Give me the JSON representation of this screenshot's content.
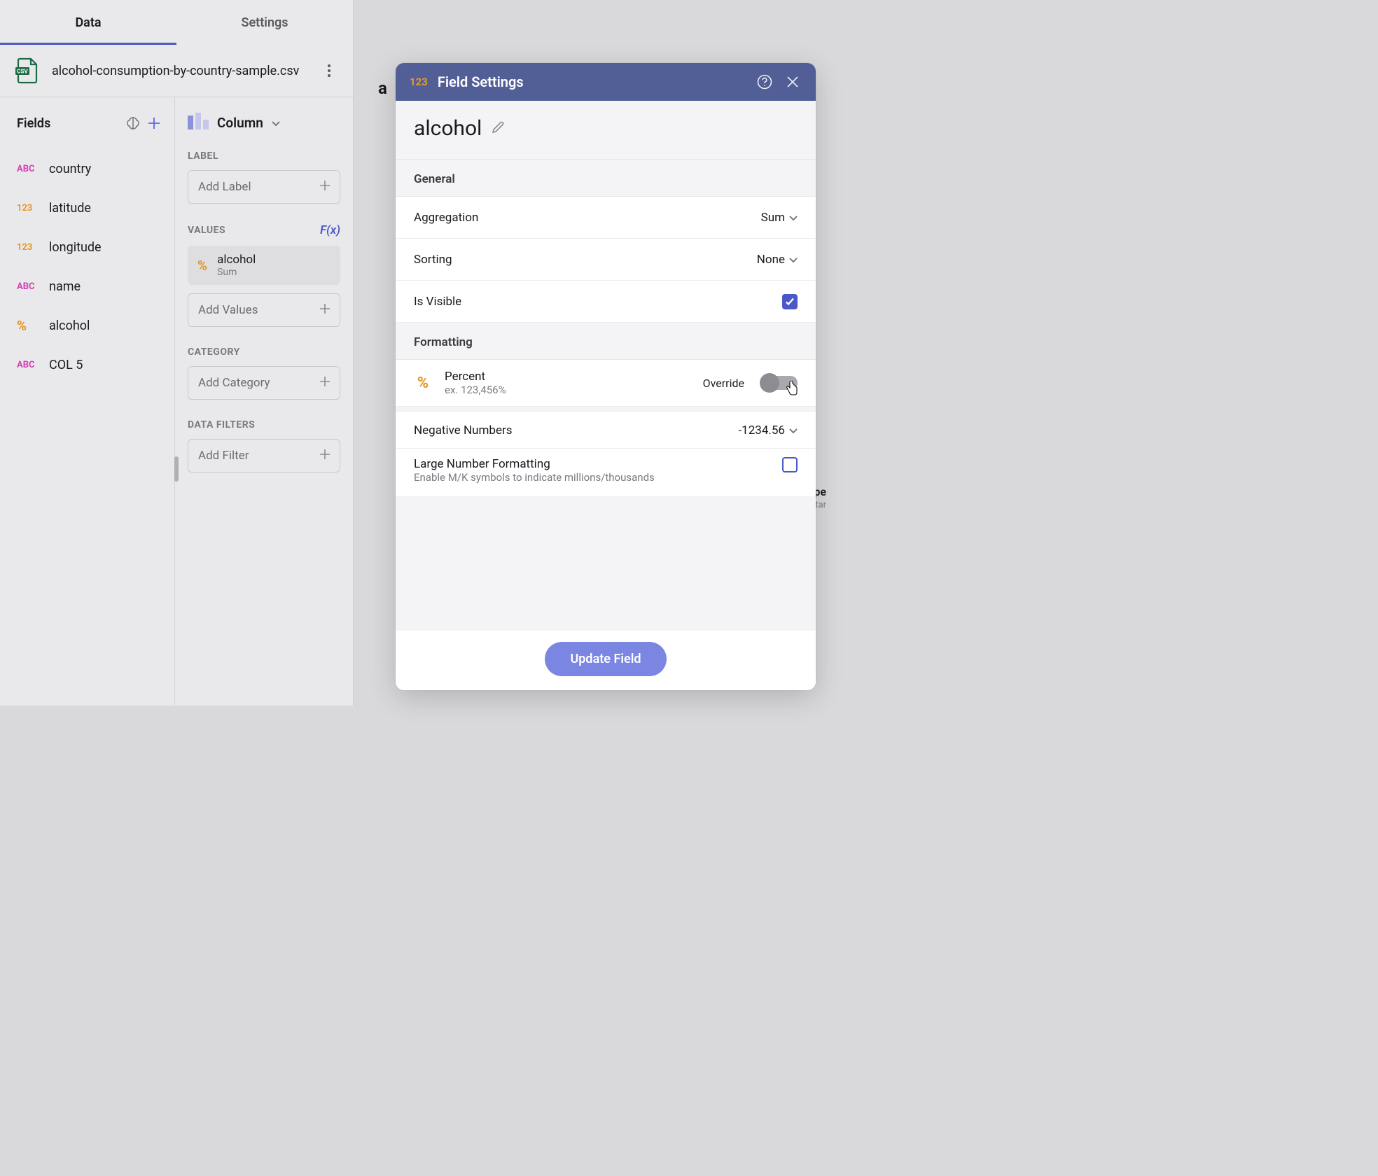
{
  "tabs": {
    "data": "Data",
    "settings": "Settings"
  },
  "file": {
    "name": "alcohol-consumption-by-country-sample.csv"
  },
  "fields": {
    "title": "Fields",
    "items": [
      {
        "type": "ABC",
        "name": "country"
      },
      {
        "type": "123",
        "name": "latitude"
      },
      {
        "type": "123",
        "name": "longitude"
      },
      {
        "type": "ABC",
        "name": "name"
      },
      {
        "type": "%",
        "name": "alcohol"
      },
      {
        "type": "ABC",
        "name": "COL 5"
      }
    ]
  },
  "config": {
    "chart_type": "Column",
    "label": {
      "title": "LABEL",
      "placeholder": "Add Label"
    },
    "values": {
      "title": "VALUES",
      "fx": "F(x)",
      "chip": {
        "name": "alcohol",
        "agg": "Sum"
      },
      "placeholder": "Add Values"
    },
    "category": {
      "title": "CATEGORY",
      "placeholder": "Add Category"
    },
    "filters": {
      "title": "DATA FILTERS",
      "placeholder": "Add Filter"
    }
  },
  "modal": {
    "tag": "123",
    "title": "Field Settings",
    "field_name": "alcohol",
    "general": {
      "title": "General",
      "aggregation": {
        "label": "Aggregation",
        "value": "Sum"
      },
      "sorting": {
        "label": "Sorting",
        "value": "None"
      },
      "visible": {
        "label": "Is Visible",
        "checked": true
      }
    },
    "formatting": {
      "title": "Formatting",
      "format": {
        "name": "Percent",
        "example": "ex. 123,456%",
        "override": "Override"
      },
      "negative": {
        "label": "Negative Numbers",
        "value": "-1234.56"
      },
      "large": {
        "title": "Large Number Formatting",
        "sub": "Enable M/K symbols to indicate millions/thousands",
        "checked": false
      }
    },
    "button": "Update Field"
  },
  "peek": {
    "a": "a",
    "pe": "pe",
    "tar": "tar"
  }
}
